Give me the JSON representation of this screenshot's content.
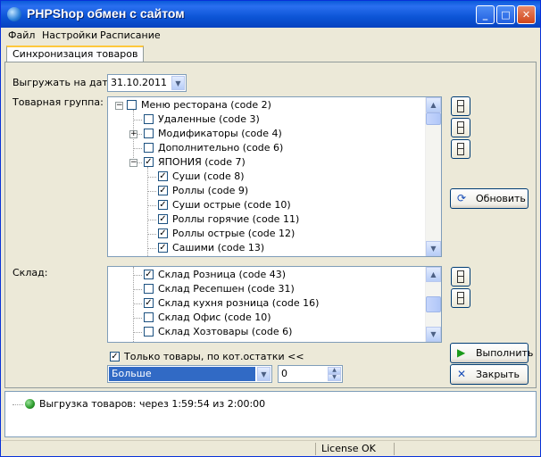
{
  "window": {
    "title": "PHPShop обмен с сайтом",
    "controls": {
      "minimize": "_",
      "maximize": "□",
      "close": "✕"
    }
  },
  "menu": [
    "Файл",
    "Настройки",
    "Расписание"
  ],
  "tabs": [
    {
      "label": "Синхронизация товаров",
      "active": true
    }
  ],
  "form": {
    "date_label": "Выгружать на дату:",
    "date_value": "31.10.2011",
    "group_label": "Товарная группа:",
    "warehouse_label": "Склад:",
    "only_stock_label": "Только товары, по кот.остатки <<",
    "only_stock_checked": true,
    "comparison_value": "Больше",
    "threshold_value": "0"
  },
  "group_tree": [
    {
      "label": "Меню ресторана (code 2)",
      "checked": false,
      "level": 0,
      "expander": "−"
    },
    {
      "label": "Удаленные (code 3)",
      "checked": false,
      "level": 1,
      "expander": ""
    },
    {
      "label": "Модификаторы (code 4)",
      "checked": false,
      "level": 1,
      "expander": "+"
    },
    {
      "label": "Дополнительно (code 6)",
      "checked": false,
      "level": 1,
      "expander": ""
    },
    {
      "label": "ЯПОНИЯ (code 7)",
      "checked": true,
      "level": 1,
      "expander": "−"
    },
    {
      "label": "Суши (code 8)",
      "checked": true,
      "level": 2,
      "expander": ""
    },
    {
      "label": "Роллы (code 9)",
      "checked": true,
      "level": 2,
      "expander": ""
    },
    {
      "label": "Суши острые (code 10)",
      "checked": true,
      "level": 2,
      "expander": ""
    },
    {
      "label": "Роллы горячие (code 11)",
      "checked": true,
      "level": 2,
      "expander": ""
    },
    {
      "label": "Роллы острые (code 12)",
      "checked": true,
      "level": 2,
      "expander": ""
    },
    {
      "label": "Сашими (code 13)",
      "checked": true,
      "level": 2,
      "expander": ""
    }
  ],
  "warehouse_list": [
    {
      "label": "Склад Розница (code 43)",
      "checked": true
    },
    {
      "label": "Склад Ресепшен (code 31)",
      "checked": false
    },
    {
      "label": "Склад кухня розница (code 16)",
      "checked": true
    },
    {
      "label": "Склад Офис (code 10)",
      "checked": false
    },
    {
      "label": "Склад Хозтовары (code 6)",
      "checked": false
    }
  ],
  "buttons": {
    "refresh": "Обновить",
    "execute": "Выполнить",
    "close": "Закрыть"
  },
  "icons": {
    "refresh": "refresh-icon",
    "execute": "play-icon",
    "close": "x-icon",
    "log_status": "green-circle-icon"
  },
  "colors": {
    "titlebar": "#0a5bd8",
    "selection": "#316ac5",
    "execute_icon": "#1a9a1a",
    "close_icon": "#1a4fb8",
    "log_status": "#2a9a2a"
  },
  "log": {
    "message": "Выгрузка товаров: через 1:59:54 из 2:00:00"
  },
  "status": {
    "license": "License OK"
  }
}
